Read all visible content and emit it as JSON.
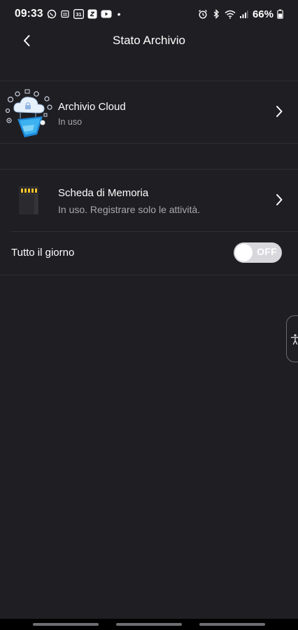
{
  "status_bar": {
    "time": "09:33",
    "battery": "66%",
    "dot": "•",
    "left_icons": [
      "whatsapp-icon",
      "calendar-icon",
      "calendar-31-icon",
      "notes-icon",
      "youtube-icon"
    ],
    "right_icons": [
      "alarm-icon",
      "bluetooth-icon",
      "wifi-icon",
      "signal-icon",
      "battery-icon"
    ],
    "calendar_day": "31"
  },
  "header": {
    "title": "Stato Archivio"
  },
  "cloud": {
    "title": "Archivio Cloud",
    "subtitle": "In uso"
  },
  "memory": {
    "title": "Scheda di Memoria",
    "subtitle": "In uso. Registrare solo le attività."
  },
  "all_day": {
    "label": "Tutto il giorno",
    "toggle_state": "OFF"
  },
  "colors": {
    "background": "#1f1f23",
    "divider": "#2e2e33",
    "text_secondary": "#a8a8ad",
    "toggle_off": "#d8d8dc"
  }
}
